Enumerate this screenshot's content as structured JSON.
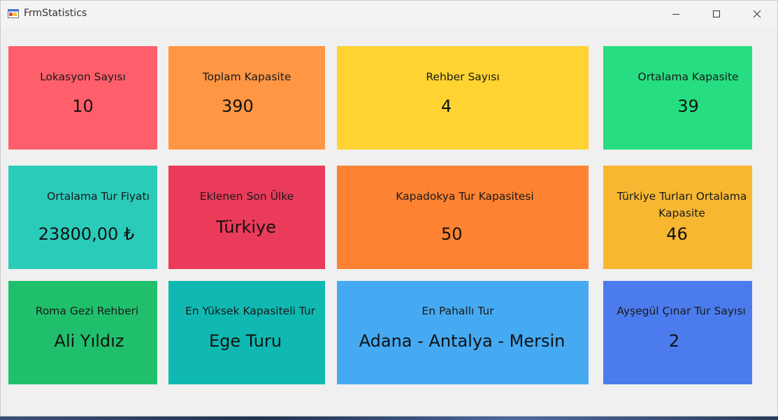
{
  "window": {
    "title": "FrmStatistics"
  },
  "controls": {
    "minimize": "minimize-icon",
    "maximize": "maximize-icon",
    "close": "close-icon"
  },
  "tiles": [
    {
      "label": "Lokasyon Sayısı",
      "value": "10",
      "color": "#ff5f6b"
    },
    {
      "label": "Toplam Kapasite",
      "value": "390",
      "color": "#ff9644"
    },
    {
      "label": "Rehber Sayısı",
      "value": "4",
      "color": "#ffd331"
    },
    {
      "label": "Ortalama Kapasite",
      "value": "39",
      "color": "#26de81"
    },
    {
      "label": "Ortalama Tur Fiyatı",
      "value": "23800,00 ₺",
      "color": "#2bcbba"
    },
    {
      "label": "Eklenen Son Ülke",
      "value": "Türkiye",
      "color": "#eb3b5a"
    },
    {
      "label": "Kapadokya Tur Kapasitesi",
      "value": "50",
      "color": "#fd8232"
    },
    {
      "label": "Türkiye Turları Ortalama Kapasite",
      "value": "46",
      "color": "#f7b731"
    },
    {
      "label": "Roma Gezi Rehberi",
      "value": "Ali Yıldız",
      "color": "#20bf6b"
    },
    {
      "label": "En Yüksek Kapasiteli Tur",
      "value": "Ege Turu",
      "color": "#0fb9b1"
    },
    {
      "label": "En Pahallı Tur",
      "value": "Adana - Antalya - Mersin",
      "color": "#45aaf2"
    },
    {
      "label": "Ayşegül Çınar Tur Sayısı",
      "value": "2",
      "color": "#4b7bec"
    }
  ]
}
